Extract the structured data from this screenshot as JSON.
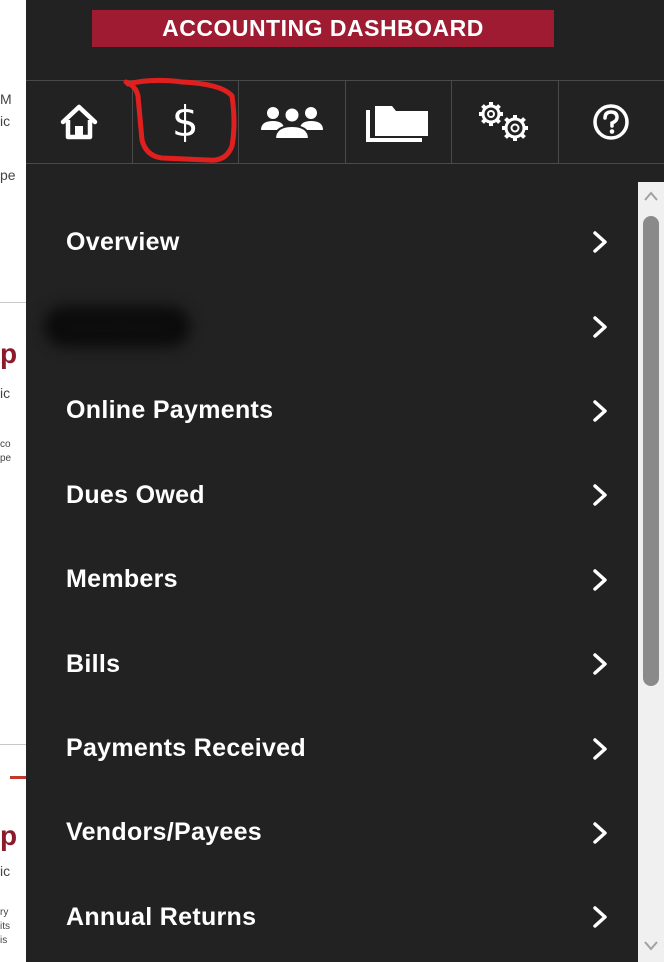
{
  "header": {
    "title": "ACCOUNTING DASHBOARD"
  },
  "toolbar": {
    "buttons": [
      {
        "icon": "home-icon"
      },
      {
        "icon": "dollar-icon",
        "glyph": "$"
      },
      {
        "icon": "people-icon"
      },
      {
        "icon": "folder-icon"
      },
      {
        "icon": "gears-icon"
      },
      {
        "icon": "help-icon"
      }
    ]
  },
  "menu": {
    "items": [
      {
        "label": "Overview"
      },
      {
        "label": "Invoices",
        "redacted": true
      },
      {
        "label": "Online Payments"
      },
      {
        "label": "Dues Owed"
      },
      {
        "label": "Members"
      },
      {
        "label": "Bills"
      },
      {
        "label": "Payments Received"
      },
      {
        "label": "Vendors/Payees"
      },
      {
        "label": "Annual Returns"
      }
    ],
    "chevron": ">"
  },
  "background_page": {
    "fragments": [
      "M",
      "ic",
      "pe",
      "p",
      "ic",
      "co",
      "pe",
      "p",
      "ic",
      "ry",
      "its",
      "is"
    ]
  },
  "colors": {
    "panel": "#222222",
    "brand": "#9e1b32",
    "annotation": "#e0201e"
  }
}
